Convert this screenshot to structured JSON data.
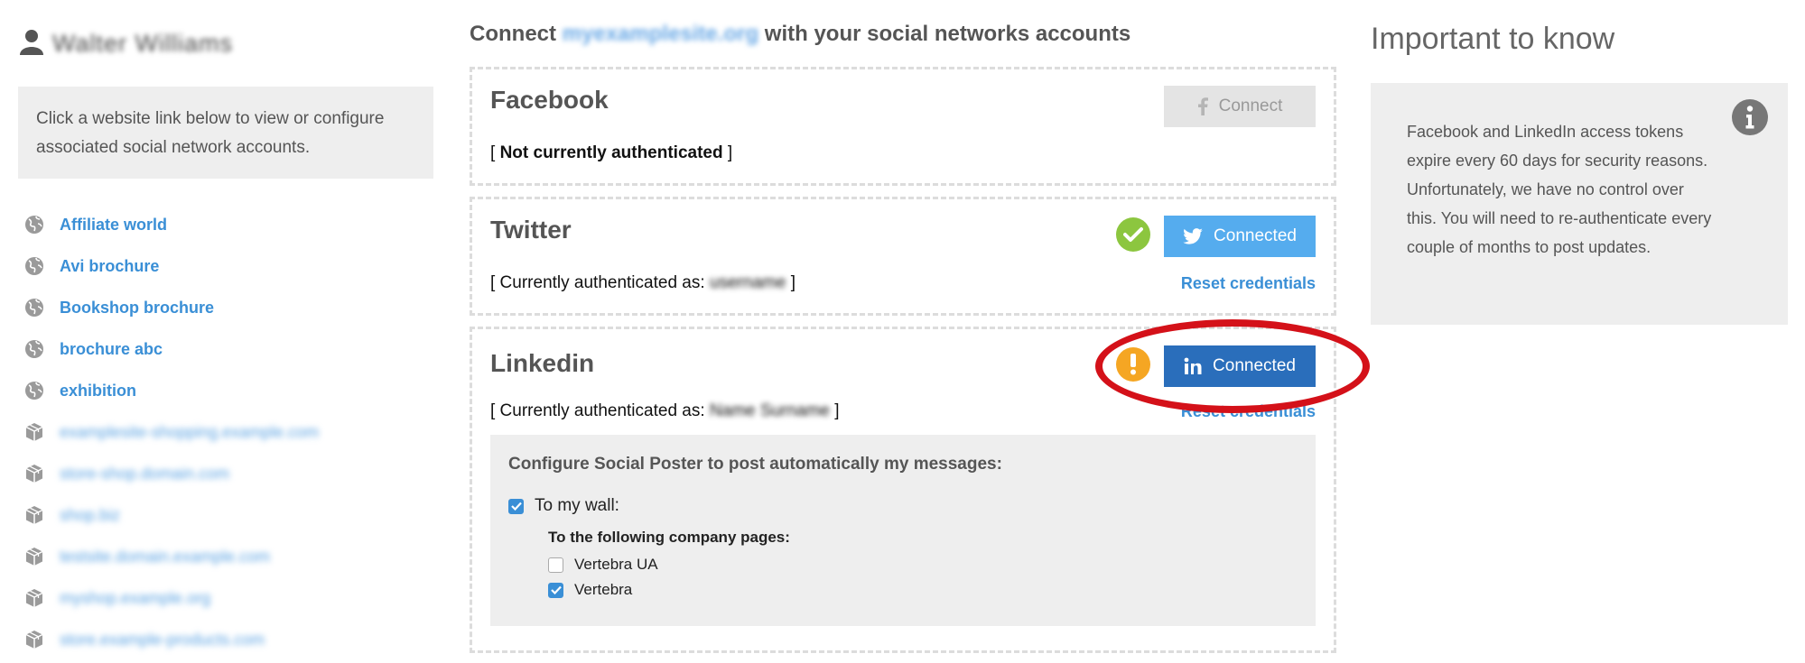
{
  "sidebar": {
    "user_name": "Walter Williams",
    "info_text": "Click a website link below to view or configure associated social network accounts.",
    "websites": [
      {
        "label": "Affiliate world",
        "icon": "globe-icon",
        "blurred": false
      },
      {
        "label": "Avi brochure",
        "icon": "globe-icon",
        "blurred": false
      },
      {
        "label": "Bookshop brochure",
        "icon": "globe-icon",
        "blurred": false
      },
      {
        "label": "brochure abc",
        "icon": "globe-icon",
        "blurred": false
      },
      {
        "label": "exhibition",
        "icon": "globe-icon",
        "blurred": false
      },
      {
        "label": "examplesite-shopping.example.com",
        "icon": "cube-icon",
        "blurred": true
      },
      {
        "label": "store-shop.domain.com",
        "icon": "cube-icon",
        "blurred": true
      },
      {
        "label": "shop.biz",
        "icon": "cube-icon",
        "blurred": true
      },
      {
        "label": "testsite.domain.example.com",
        "icon": "cube-icon",
        "blurred": true
      },
      {
        "label": "myshop.example.org",
        "icon": "cube-icon",
        "blurred": true
      },
      {
        "label": "store.example-products.com",
        "icon": "cube-icon",
        "blurred": true
      }
    ]
  },
  "center": {
    "title_prefix": "Connect",
    "title_domain": "myexamplesite.org",
    "title_suffix": "with your social networks accounts",
    "facebook": {
      "name": "Facebook",
      "button": "Connect",
      "auth_open": "[",
      "auth_text": "Not currently authenticated",
      "auth_close": "]"
    },
    "twitter": {
      "name": "Twitter",
      "button": "Connected",
      "auth_label": "[ Currently authenticated as:",
      "auth_user": "username",
      "auth_close": "]",
      "reset": "Reset credentials"
    },
    "linkedin": {
      "name": "Linkedin",
      "button": "Connected",
      "auth_label": "[ Currently authenticated as:",
      "auth_user": "Name Surname",
      "auth_close": "]",
      "reset": "Reset credentials",
      "config_title": "Configure Social Poster to post automatically my messages:",
      "wall_label": "To my wall:",
      "wall_checked": true,
      "company_title": "To the following company pages:",
      "companies": [
        {
          "label": "Vertebra UA",
          "checked": false
        },
        {
          "label": "Vertebra",
          "checked": true
        }
      ]
    }
  },
  "right": {
    "title": "Important to know",
    "note": "Facebook and LinkedIn access tokens expire every 60 days for security reasons. Unfortunately, we have no control over this. You will need to re-authenticate every couple of months to post updates."
  },
  "colors": {
    "link": "#3a8fd6",
    "twitter": "#55acee",
    "linkedin": "#2a6ebb",
    "ok_green": "#8cc63f",
    "warn_orange": "#f5a623",
    "highlight_red": "#d41119"
  }
}
